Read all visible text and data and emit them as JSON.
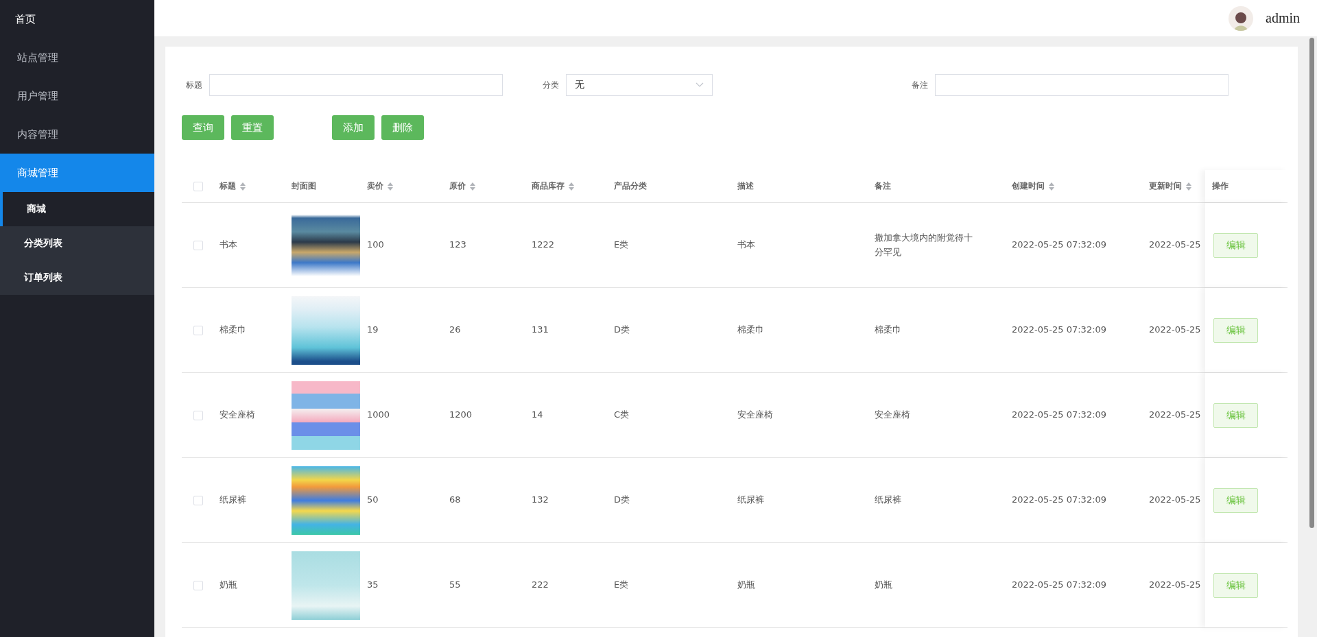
{
  "sidebar": {
    "items": [
      {
        "label": "首页",
        "kind": "home",
        "selected": false
      },
      {
        "label": "站点管理",
        "kind": "menu",
        "selected": false
      },
      {
        "label": "用户管理",
        "kind": "menu",
        "selected": false
      },
      {
        "label": "内容管理",
        "kind": "menu",
        "selected": false
      },
      {
        "label": "商城管理",
        "kind": "menu",
        "selected": true,
        "expanded": true,
        "children": [
          {
            "label": "商城",
            "selected": true
          },
          {
            "label": "分类列表",
            "selected": false
          },
          {
            "label": "订单列表",
            "selected": false
          }
        ]
      }
    ]
  },
  "header": {
    "user": "admin"
  },
  "filters": [
    {
      "label": "标题",
      "kind": "text"
    },
    {
      "label": "分类",
      "kind": "select",
      "value": "无"
    },
    {
      "label": "备注",
      "kind": "text"
    }
  ],
  "buttons": [
    {
      "label": "查询"
    },
    {
      "label": "重置"
    },
    {
      "label": "添加"
    },
    {
      "label": "删除"
    }
  ],
  "table": {
    "all_selected": false,
    "columns": [
      {
        "label": "标题",
        "sortable": true
      },
      {
        "label": "封面图",
        "sortable": false
      },
      {
        "label": "卖价",
        "sortable": true
      },
      {
        "label": "原价",
        "sortable": true
      },
      {
        "label": "商品库存",
        "sortable": true
      },
      {
        "label": "产品分类",
        "sortable": false
      },
      {
        "label": "描述",
        "sortable": false
      },
      {
        "label": "备注",
        "sortable": false
      },
      {
        "label": "创建时间",
        "sortable": true
      },
      {
        "label": "更新时间",
        "sortable": true
      },
      {
        "label": "操作",
        "sortable": false
      }
    ],
    "rows": [
      {
        "selected": false,
        "title": "书本",
        "price": "100",
        "original": "123",
        "stock": "1222",
        "category": "E类",
        "description": "书本",
        "remark": "撒加拿大境内的附觉得十分罕见",
        "created": "2022-05-25 07:32:09",
        "updated": "2022-05-25",
        "action": "编辑"
      },
      {
        "selected": false,
        "title": "棉柔巾",
        "price": "19",
        "original": "26",
        "stock": "131",
        "category": "D类",
        "description": "棉柔巾",
        "remark": "棉柔巾",
        "created": "2022-05-25 07:32:09",
        "updated": "2022-05-25",
        "action": "编辑"
      },
      {
        "selected": false,
        "title": "安全座椅",
        "price": "1000",
        "original": "1200",
        "stock": "14",
        "category": "C类",
        "description": "安全座椅",
        "remark": "安全座椅",
        "created": "2022-05-25 07:32:09",
        "updated": "2022-05-25",
        "action": "编辑"
      },
      {
        "selected": false,
        "title": "纸尿裤",
        "price": "50",
        "original": "68",
        "stock": "132",
        "category": "D类",
        "description": "纸尿裤",
        "remark": "纸尿裤",
        "created": "2022-05-25 07:32:09",
        "updated": "2022-05-25",
        "action": "编辑"
      },
      {
        "selected": false,
        "title": "奶瓶",
        "price": "35",
        "original": "55",
        "stock": "222",
        "category": "E类",
        "description": "奶瓶",
        "remark": "奶瓶",
        "created": "2022-05-25 07:32:09",
        "updated": "2022-05-25",
        "action": "编辑"
      }
    ]
  }
}
